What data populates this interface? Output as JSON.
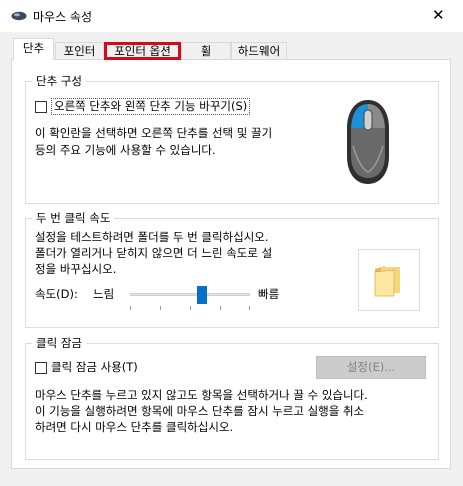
{
  "window": {
    "title": "마우스 속성",
    "close_glyph": "✕"
  },
  "tabs": [
    {
      "label": "단추"
    },
    {
      "label": "포인터"
    },
    {
      "label": "포인터 옵션"
    },
    {
      "label": "휠"
    },
    {
      "label": "하드웨어"
    }
  ],
  "active_tab": "단추",
  "highlighted_tab": "포인터 옵션",
  "highlight_color": "#d40a1a",
  "button_config": {
    "title": "단추 구성",
    "swap_checkbox_label": "오른쪽 단추와 왼쪽 단추 기능 바꾸기(S)",
    "swap_checked": false,
    "description_line1": "이 확인란을 선택하면 오른쪽 단추를 선택 및 끌기",
    "description_line2": "등의 주요 기능에 사용할 수 있습니다.",
    "mouse_icon": "mouse-icon",
    "mouse_accent_color": "#1e90d8"
  },
  "double_click": {
    "title": "두 번 클릭 속도",
    "description_line1": "설정을 테스트하려면 폴더를 두 번 클릭하십시오.",
    "description_line2": "폴더가 열리거나 닫히지 않으면 더 느린 속도로 설",
    "description_line3": "정을 바꾸십시오.",
    "speed_label": "속도(D):",
    "slow_label": "느림",
    "fast_label": "빠름",
    "speed_fraction": 0.6,
    "folder_icon": "folder-icon",
    "slider_color": "#0a6fc8"
  },
  "click_lock": {
    "title": "클릭 잠금",
    "checkbox_label": "클릭 잠금 사용(T)",
    "checked": false,
    "settings_button": "설정(E)...",
    "description_line1": "마우스 단추를 누르고 있지 않고도 항목을 선택하거나 끌 수 있습니다.",
    "description_line2": "이 기능을 실행하려면 항목에 마우스 단추를 잠시 누르고 실행을 취소",
    "description_line3": "하려면 다시 마우스 단추를 클릭하십시오."
  }
}
